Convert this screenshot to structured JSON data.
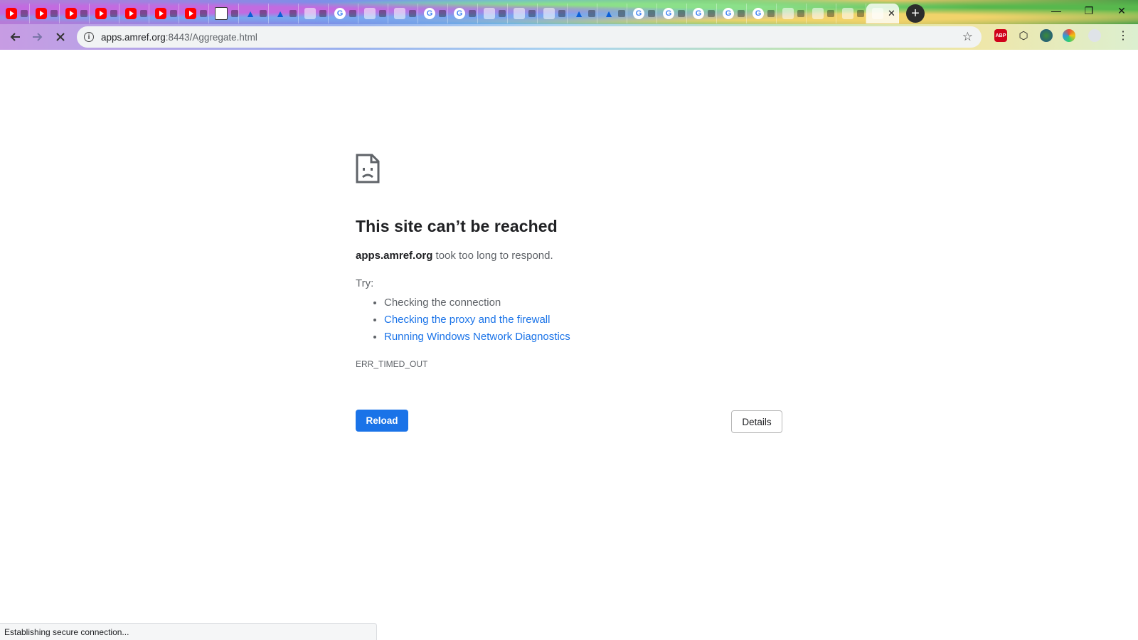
{
  "tabs": {
    "favicons": [
      "youtube-icon",
      "youtube-icon",
      "youtube-icon",
      "youtube-icon",
      "youtube-icon",
      "youtube-icon",
      "youtube-icon",
      "image-icon",
      "azure-icon",
      "azure-icon",
      "misc-icon",
      "google-icon",
      "misc-icon",
      "leaf-icon",
      "google-icon",
      "google-icon",
      "misc-icon",
      "misc-icon",
      "misc-icon",
      "misc-icon",
      "azure-icon",
      "azure-icon",
      "google-icon",
      "google-icon",
      "google-icon",
      "google-icon",
      "google-icon",
      "misc-icon",
      "misc-icon",
      "misc-icon",
      "misc-icon"
    ]
  },
  "toolbar": {
    "url_host": "apps.amref.org",
    "url_rest": ":8443/Aggregate.html"
  },
  "error": {
    "title": "This site can’t be reached",
    "host": "apps.amref.org",
    "message": " took too long to respond.",
    "try_label": "Try:",
    "suggestions": [
      {
        "text": "Checking the connection",
        "link": false
      },
      {
        "text": "Checking the proxy and the firewall",
        "link": true
      },
      {
        "text": "Running Windows Network Diagnostics",
        "link": true
      }
    ],
    "code": "ERR_TIMED_OUT",
    "reload_label": "Reload",
    "details_label": "Details"
  },
  "status_bar": {
    "text": "Establishing secure connection..."
  },
  "colors": {
    "primary": "#1a73e8",
    "text": "#202124",
    "secondary_text": "#5f6368"
  }
}
